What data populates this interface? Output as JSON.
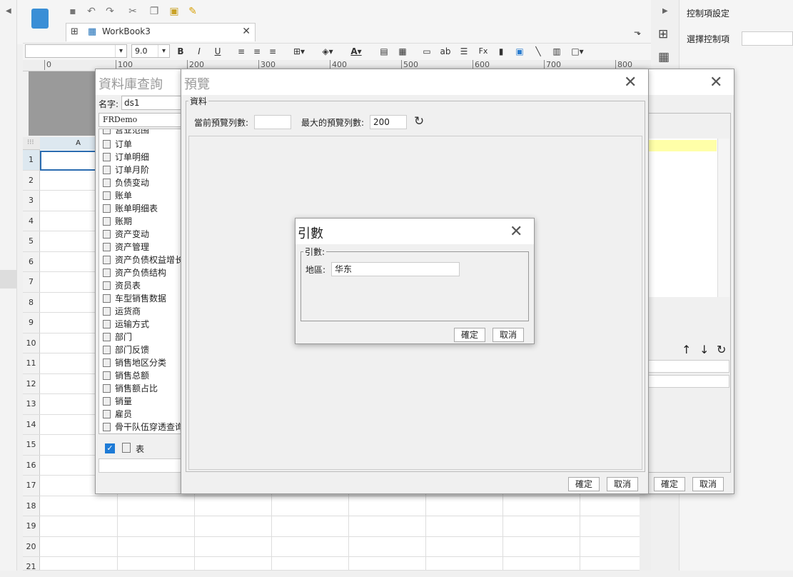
{
  "app": {
    "tab_title": "WorkBook3",
    "font_size": "9.0",
    "ruler_ticks": [
      "0",
      "100",
      "200",
      "300",
      "400",
      "500",
      "600",
      "700",
      "800"
    ],
    "column_a": "A",
    "row_numbers": [
      "1",
      "2",
      "3",
      "4",
      "5",
      "6",
      "7",
      "8",
      "9",
      "10",
      "11",
      "12",
      "13",
      "14",
      "15",
      "16",
      "17",
      "18",
      "19",
      "20",
      "21"
    ]
  },
  "right_panel": {
    "title": "控制項設定",
    "select_label": "選擇控制項"
  },
  "db_query": {
    "title": "資料庫查詢",
    "name_label": "名字:",
    "name_value": "ds1",
    "source": "FRDemo",
    "tables": [
      "营业范围",
      "订单",
      "订单明细",
      "订单月阶",
      "负债变动",
      "账单",
      "账单明细表",
      "账期",
      "资产变动",
      "资产管理",
      "资产负债权益增长",
      "资产负债结构",
      "资员表",
      "车型销售数据",
      "运货商",
      "运输方式",
      "部门",
      "部门反馈",
      "销售地区分类",
      "销售总额",
      "销售额占比",
      "销量",
      "雇员",
      "骨干队伍穿透查询"
    ],
    "table_checkbox_label": "表",
    "ok": "確定",
    "cancel": "取消"
  },
  "preview": {
    "title": "預覽",
    "group_label": "資料",
    "current_rows_label": "當前預覽列數:",
    "current_rows_value": "",
    "max_rows_label": "最大的預覽列數:",
    "max_rows_value": "200",
    "ok": "確定",
    "cancel": "取消"
  },
  "params": {
    "title": "引數",
    "group_label": "引數:",
    "region_label": "地區:",
    "region_value": "华东",
    "ok": "確定",
    "cancel": "取消"
  }
}
